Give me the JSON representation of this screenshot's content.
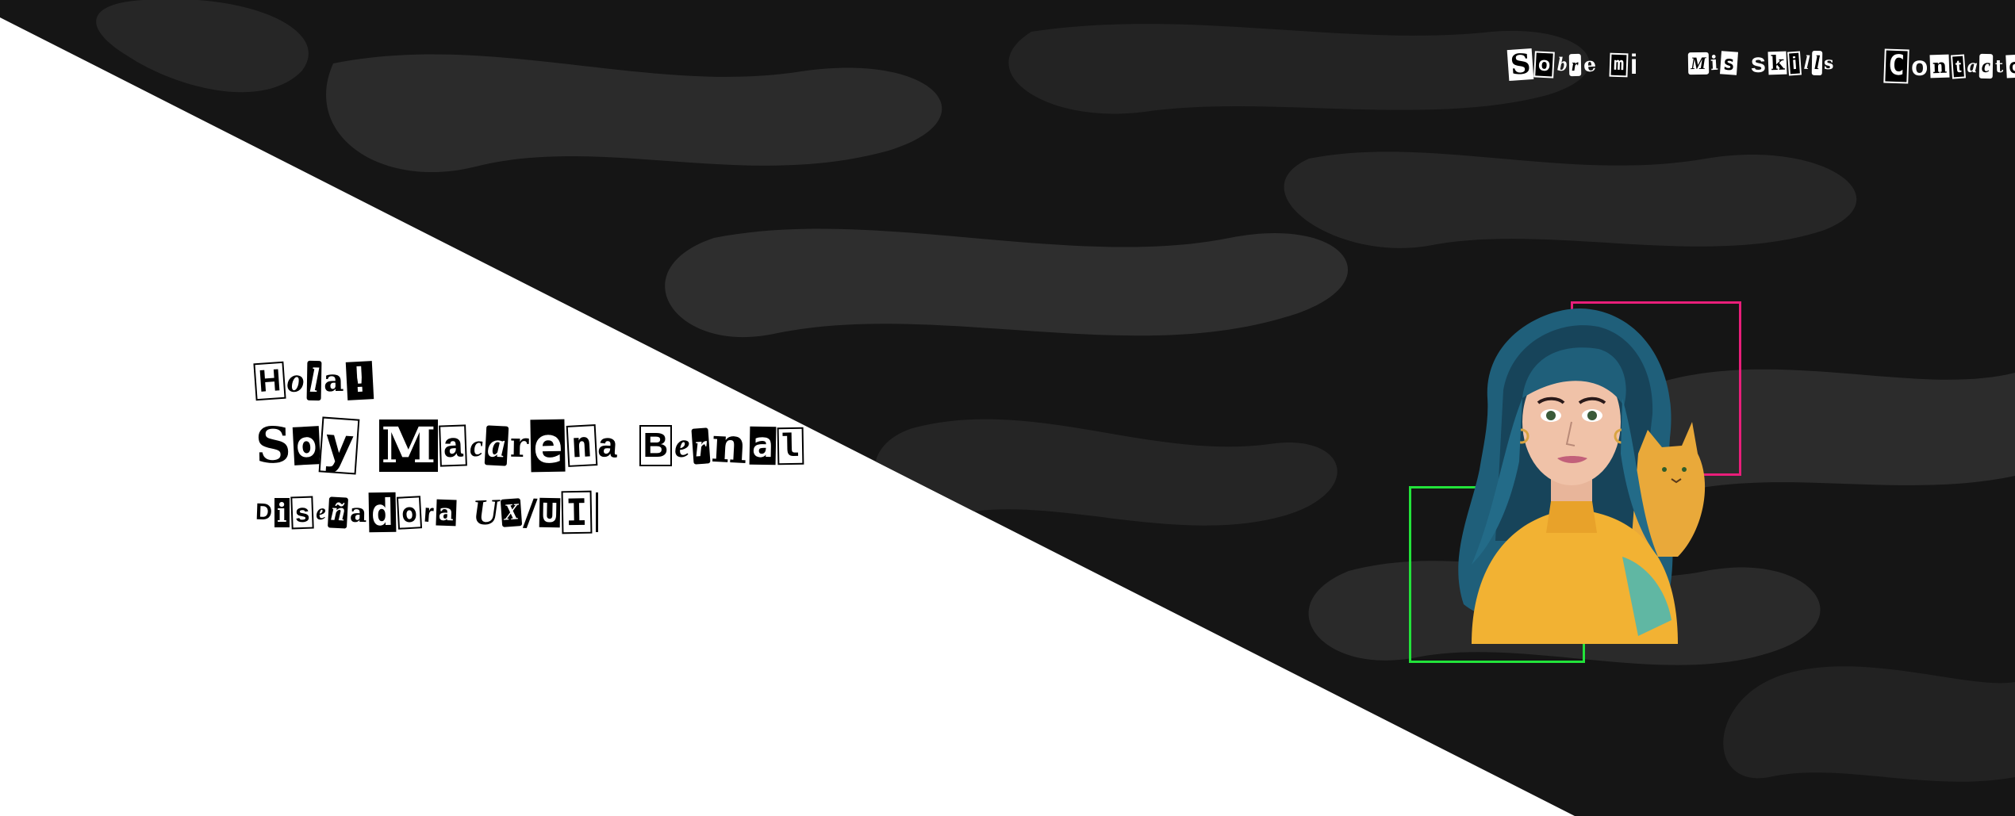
{
  "nav": {
    "items": [
      {
        "label": "Sobre mi"
      },
      {
        "label": "Mis skills"
      },
      {
        "label": "Contacto"
      }
    ]
  },
  "hero": {
    "greeting": "Hola!",
    "intro": "Soy Macarena Bernal",
    "role": "Diseñadora UX/UI"
  },
  "colors": {
    "background_light": "#ffffff",
    "background_dark": "#151515",
    "camo_gray": "#2e2e2e",
    "frame_pink": "#e91e7a",
    "frame_green": "#22e33a",
    "sweater": "#f2b233",
    "hair": "#1f5f7a"
  },
  "icons": {
    "avatar": "illustrated-portrait-with-cat"
  }
}
